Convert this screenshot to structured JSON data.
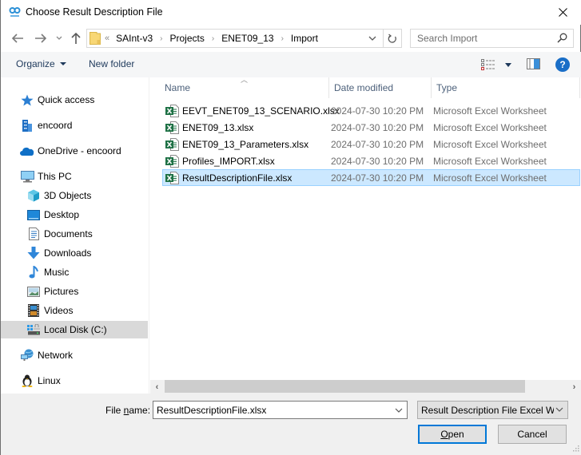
{
  "window": {
    "title": "Choose Result Description File",
    "app_icon": "saint-app-icon",
    "close_icon": "close-icon"
  },
  "navigation": {
    "back_icon": "back-arrow-icon",
    "forward_icon": "forward-arrow-icon",
    "recent_icon": "chevron-down-icon",
    "up_icon": "up-arrow-icon",
    "address": {
      "overflow_marker": "«",
      "crumbs": [
        "SAInt-v3",
        "Projects",
        "ENET09_13",
        "Import"
      ],
      "separator": "›"
    },
    "search": {
      "placeholder": "Search Import",
      "value": ""
    }
  },
  "commandbar": {
    "organize_label": "Organize",
    "new_folder_label": "New folder",
    "help_label": "?"
  },
  "sidebar": {
    "items": [
      {
        "label": "Quick access",
        "icon": "star-icon",
        "level": 1
      },
      {
        "label": "encoord",
        "icon": "building-icon",
        "level": 1
      },
      {
        "label": "OneDrive - encoord",
        "icon": "cloud-icon",
        "level": 1
      },
      {
        "label": "This PC",
        "icon": "computer-icon",
        "level": 1
      },
      {
        "label": "3D Objects",
        "icon": "cube-icon",
        "level": 2
      },
      {
        "label": "Desktop",
        "icon": "desktop-icon",
        "level": 2
      },
      {
        "label": "Documents",
        "icon": "document-icon",
        "level": 2
      },
      {
        "label": "Downloads",
        "icon": "download-icon",
        "level": 2
      },
      {
        "label": "Music",
        "icon": "music-icon",
        "level": 2
      },
      {
        "label": "Pictures",
        "icon": "pictures-icon",
        "level": 2
      },
      {
        "label": "Videos",
        "icon": "videos-icon",
        "level": 2
      },
      {
        "label": "Local Disk (C:)",
        "icon": "drive-icon",
        "level": 2,
        "selected": true
      },
      {
        "label": "Network",
        "icon": "network-icon",
        "level": 1
      },
      {
        "label": "Linux",
        "icon": "linux-icon",
        "level": 1
      }
    ]
  },
  "filelist": {
    "columns": [
      "Name",
      "Date modified",
      "Type"
    ],
    "sorted_by": "Name",
    "rows": [
      {
        "name": "EEVT_ENET09_13_SCENARIO.xlsx",
        "date": "2024-07-30 10:20 PM",
        "type": "Microsoft Excel Worksheet",
        "selected": false
      },
      {
        "name": "ENET09_13.xlsx",
        "date": "2024-07-30 10:20 PM",
        "type": "Microsoft Excel Worksheet",
        "selected": false
      },
      {
        "name": "ENET09_13_Parameters.xlsx",
        "date": "2024-07-30 10:20 PM",
        "type": "Microsoft Excel Worksheet",
        "selected": false
      },
      {
        "name": "Profiles_IMPORT.xlsx",
        "date": "2024-07-30 10:20 PM",
        "type": "Microsoft Excel Worksheet",
        "selected": false
      },
      {
        "name": "ResultDescriptionFile.xlsx",
        "date": "2024-07-30 10:20 PM",
        "type": "Microsoft Excel Worksheet",
        "selected": true
      }
    ]
  },
  "footer": {
    "filename_label_pre": "File ",
    "filename_label_mnemonic": "n",
    "filename_label_post": "ame:",
    "filename_value": "ResultDescriptionFile.xlsx",
    "filter_value": "Result Description File Excel Wc",
    "open_mnemonic": "O",
    "open_rest": "pen",
    "cancel_label": "Cancel"
  },
  "colors": {
    "selection_bg": "#cce8ff",
    "selection_border": "#99d1ff",
    "accent": "#0078d7",
    "help_blue": "#1a6ec7",
    "excel_green": "#1e7145"
  }
}
